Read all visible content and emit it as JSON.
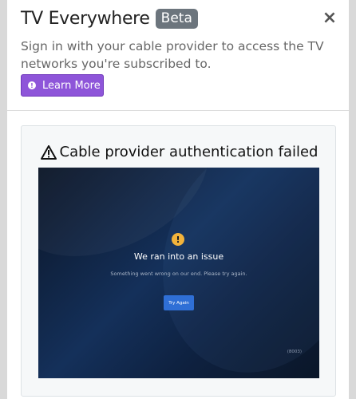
{
  "header": {
    "title": "TV Everywhere",
    "badge": "Beta",
    "close_label": "×",
    "subtitle": "Sign in with your cable provider to access the TV networks you're subscribed to.",
    "learn_more_label": "Learn More"
  },
  "card": {
    "title": "Cable provider authentication failed"
  },
  "embedded": {
    "alert_glyph": "!",
    "issue_title": "We ran into an issue",
    "issue_description": "Something went wrong on our end. Please try again.",
    "try_again_label": "Try Again",
    "error_code": "(8003)"
  },
  "colors": {
    "accent_purple": "#8e55d9",
    "badge_gray": "#6c757d",
    "try_button_blue": "#2f6fd6",
    "alert_yellow": "#f2b33b"
  }
}
